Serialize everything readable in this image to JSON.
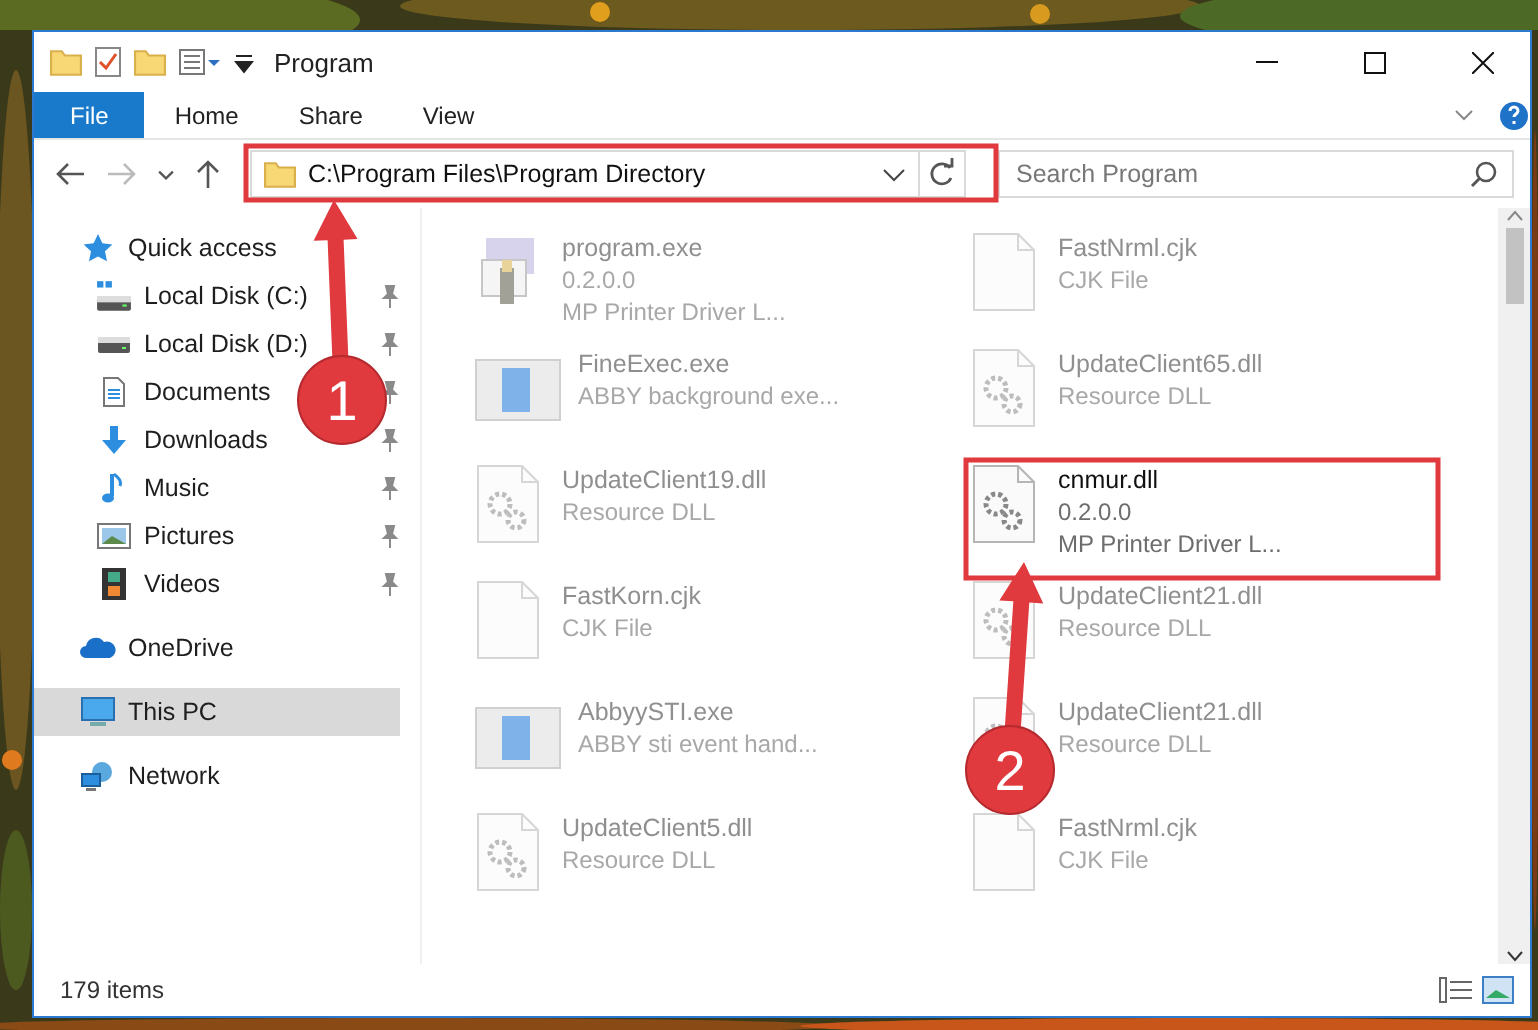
{
  "window": {
    "title": "Program"
  },
  "ribbon": {
    "tabs": [
      {
        "label": "File",
        "kind": "file",
        "selected": false
      },
      {
        "label": "Home",
        "kind": "tab",
        "selected": false
      },
      {
        "label": "Share",
        "kind": "tab",
        "selected": false
      },
      {
        "label": "View",
        "kind": "tab",
        "selected": false
      }
    ]
  },
  "address_bar": {
    "path": "C:\\Program Files\\Program Directory"
  },
  "search": {
    "placeholder": "Search Program"
  },
  "sidebar": {
    "items": [
      {
        "label": "Quick access",
        "selected": false,
        "children": [
          {
            "label": "Local Disk (C:)",
            "pinned": true
          },
          {
            "label": "Local Disk (D:)",
            "pinned": true
          },
          {
            "label": "Documents",
            "pinned": true
          },
          {
            "label": "Downloads",
            "pinned": true
          },
          {
            "label": "Music",
            "pinned": true
          },
          {
            "label": "Pictures",
            "pinned": true
          },
          {
            "label": "Videos",
            "pinned": true
          }
        ]
      },
      {
        "label": "OneDrive",
        "selected": false
      },
      {
        "label": "This PC",
        "selected": true
      },
      {
        "label": "Network",
        "selected": false
      }
    ]
  },
  "files": [
    {
      "name": "program.exe",
      "details": [
        "0.2.0.0",
        "MP Printer Driver L..."
      ],
      "highlighted": false
    },
    {
      "name": "FastNrml.cjk",
      "details": [
        "CJK File"
      ],
      "highlighted": false
    },
    {
      "name": "FineExec.exe",
      "details": [
        "ABBY background exe..."
      ],
      "highlighted": false
    },
    {
      "name": "UpdateClient65.dll",
      "details": [
        "Resource DLL"
      ],
      "highlighted": false
    },
    {
      "name": "UpdateClient19.dll",
      "details": [
        "Resource DLL"
      ],
      "highlighted": false
    },
    {
      "name": "cnmur.dll",
      "details": [
        "0.2.0.0",
        "MP Printer Driver L..."
      ],
      "highlighted": true
    },
    {
      "name": "FastKorn.cjk",
      "details": [
        "CJK File"
      ],
      "highlighted": false
    },
    {
      "name": "UpdateClient21.dll",
      "details": [
        "Resource DLL"
      ],
      "highlighted": false
    },
    {
      "name": "AbbyySTI.exe",
      "details": [
        "ABBY sti event hand..."
      ],
      "highlighted": false
    },
    {
      "name": "UpdateClient21.dll",
      "details": [
        "Resource DLL"
      ],
      "highlighted": false
    },
    {
      "name": "UpdateClient5.dll",
      "details": [
        "Resource DLL"
      ],
      "highlighted": false
    },
    {
      "name": "FastNrml.cjk",
      "details": [
        "CJK File"
      ],
      "highlighted": false
    }
  ],
  "status_bar": {
    "count": "179 items"
  },
  "annotations": [
    {
      "label": "1"
    },
    {
      "label": "2"
    }
  ]
}
